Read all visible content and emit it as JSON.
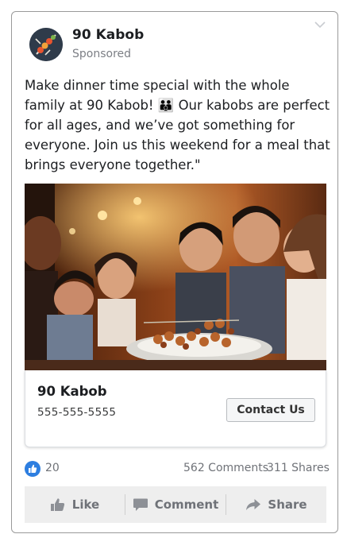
{
  "post": {
    "page_name": "90 Kabob",
    "sponsored_label": "Sponsored",
    "logo_icon": "kabob-skewer-icon",
    "text": "Make dinner time special with the whole family at 90 Kabob! 👪 Our kabobs are perfect for all ages, and we’ve got something for everyone. Join us this weekend for a meal that brings everyone together.\""
  },
  "link": {
    "title": "90 Kabob",
    "phone": "555-555-5555",
    "cta_label": "Contact Us"
  },
  "stats": {
    "likes": "20",
    "comments": "562 Comments",
    "shares": "311 Shares"
  },
  "actions": {
    "like_label": "Like",
    "comment_label": "Comment",
    "share_label": "Share"
  },
  "colors": {
    "like_blue": "#2d7ee0",
    "logo_bg": "#2f3b4a"
  }
}
